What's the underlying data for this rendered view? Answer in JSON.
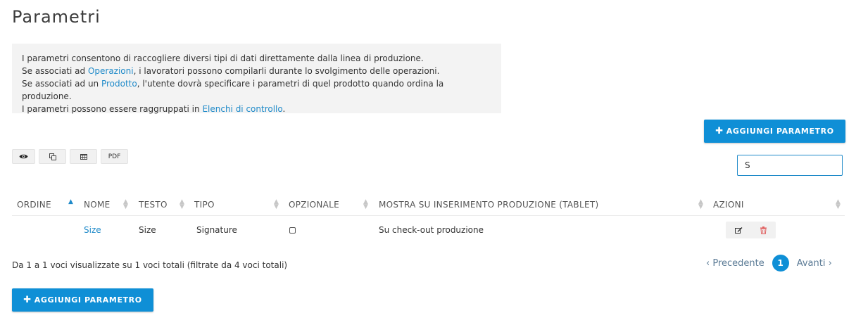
{
  "page": {
    "title": "Parametri"
  },
  "info": {
    "line1": "I parametri consentono di raccogliere diversi tipi di dati direttamente dalla linea di produzione.",
    "line2_before": "Se associati ad ",
    "line2_link": "Operazioni",
    "line2_after": ", i lavoratori possono compilarli durante lo svolgimento delle operazioni.",
    "line3_before": "Se associati ad un ",
    "line3_link": "Prodotto",
    "line3_after": ", l'utente dovrà specificare i parametri di quel prodotto quando ordina la produzione.",
    "line4_before": "I parametri possono essere raggruppati in ",
    "line4_link": "Elenchi di controllo",
    "line4_after": "."
  },
  "actions": {
    "add_label": "AGGIUNGI PARAMETRO",
    "add_icon": "plus-icon"
  },
  "toolbar": {
    "pdf_label": "PDF"
  },
  "search": {
    "value": "S"
  },
  "table": {
    "headers": {
      "ordine": "ORDINE",
      "nome": "NOME",
      "testo": "TESTO",
      "tipo": "TIPO",
      "opzionale": "OPZIONALE",
      "mostra": "MOSTRA SU INSERIMENTO PRODUZIONE (TABLET)",
      "azioni": "AZIONI"
    },
    "rows": [
      {
        "ordine": "",
        "nome": "Size",
        "testo": "Size",
        "tipo": "Signature",
        "opzionale": false,
        "mostra": "Su check-out produzione"
      }
    ]
  },
  "footer": {
    "info": "Da 1 a 1 voci visualizzate su 1 voci totali (filtrate da 4 voci totali)",
    "prev": "‹ Precedente",
    "page": "1",
    "next": "Avanti ›"
  },
  "colors": {
    "accent": "#0f8fd6",
    "link": "#1f8ac9",
    "info_bg": "#f3f3f3",
    "delete": "#e06060"
  }
}
